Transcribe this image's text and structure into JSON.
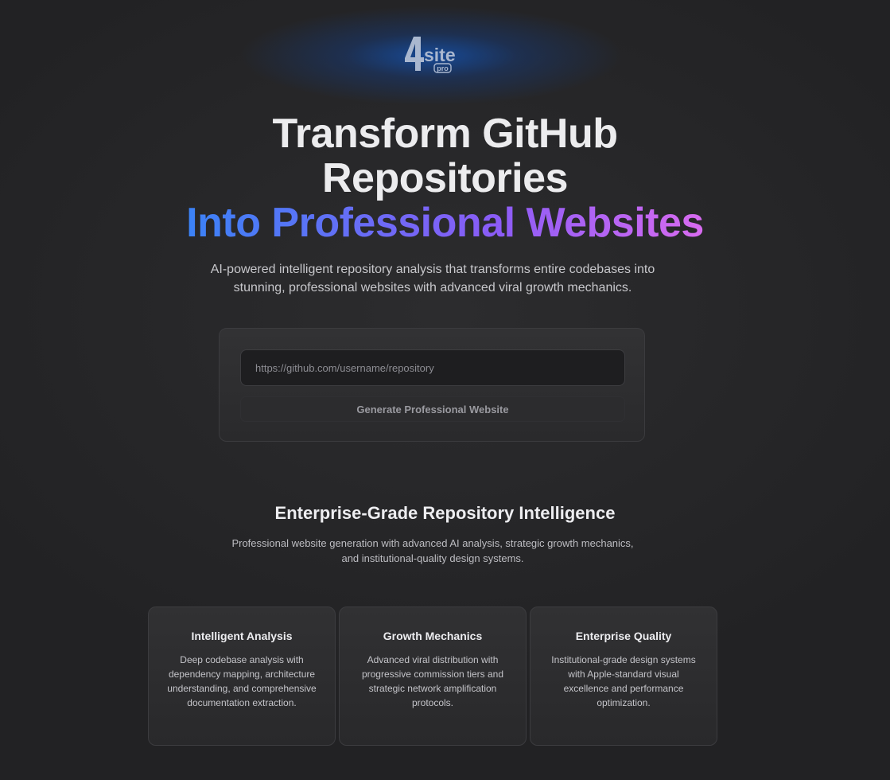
{
  "brand": {
    "logo_text": "4site",
    "logo_badge": "pro"
  },
  "hero": {
    "title_line1": "Transform GitHub",
    "title_line2": "Repositories",
    "title_line3": "Into Professional Websites",
    "subtitle": "AI-powered intelligent repository analysis that transforms entire codebases into stunning, professional websites with advanced viral growth mechanics.",
    "accent_gradient": [
      "#3b82f6",
      "#8b5cf6",
      "#d86bf0"
    ]
  },
  "form": {
    "input_placeholder": "https://github.com/username/repository",
    "input_value": "",
    "button_label": "Generate Professional Website"
  },
  "features_section": {
    "title": "Enterprise-Grade Repository Intelligence",
    "subtitle": "Professional website generation with advanced AI analysis, strategic growth mechanics, and institutional-quality design systems.",
    "cards": [
      {
        "title": "Intelligent Analysis",
        "description": "Deep codebase analysis with dependency mapping, architecture understanding, and comprehensive documentation extraction."
      },
      {
        "title": "Growth Mechanics",
        "description": "Advanced viral distribution with progressive commission tiers and strategic network amplification protocols."
      },
      {
        "title": "Enterprise Quality",
        "description": "Institutional-grade design systems with Apple-standard visual excellence and performance optimization."
      }
    ]
  }
}
